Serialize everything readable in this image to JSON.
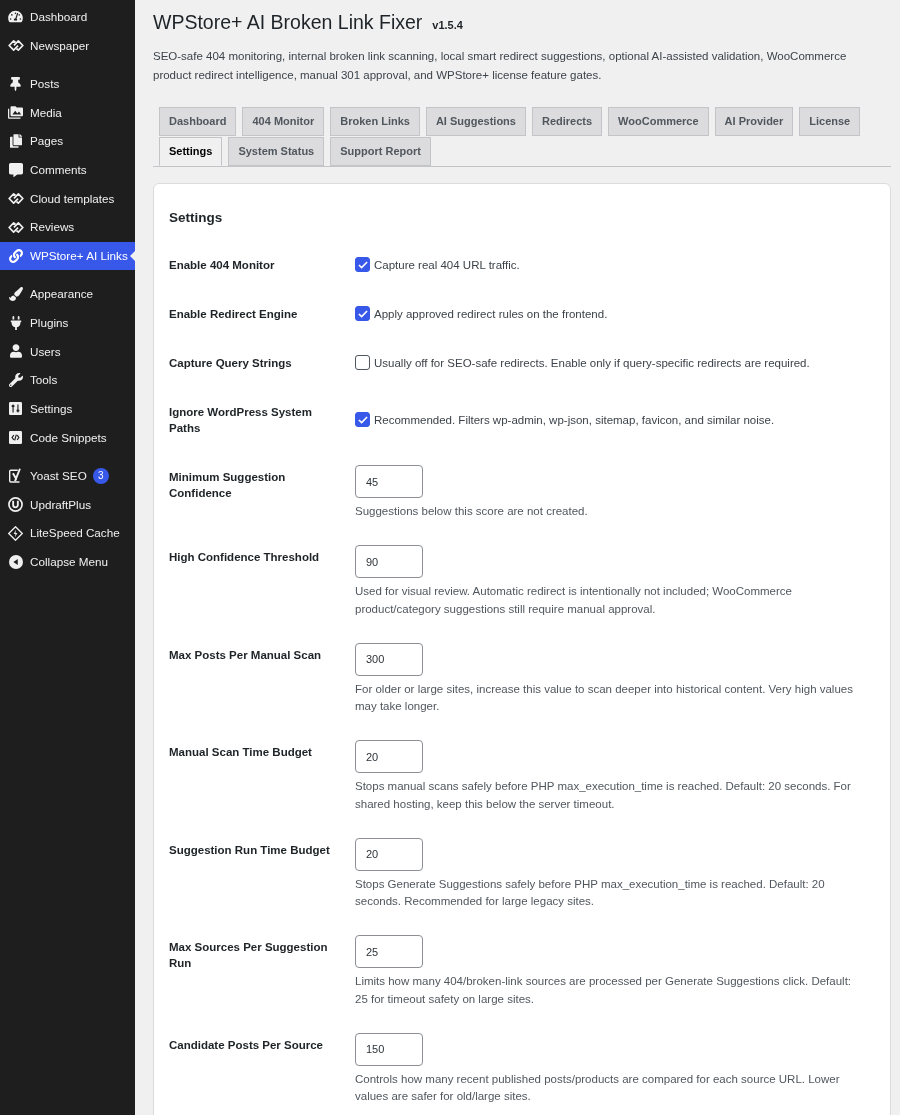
{
  "sidebar": {
    "groups": [
      {
        "items": [
          {
            "label": "Dashboard",
            "selected": false
          },
          {
            "label": "Newspaper",
            "selected": false
          }
        ]
      },
      {
        "items": [
          {
            "label": "Posts",
            "selected": false
          },
          {
            "label": "Media",
            "selected": false
          },
          {
            "label": "Pages",
            "selected": false
          },
          {
            "label": "Comments",
            "selected": false
          },
          {
            "label": "Cloud templates",
            "selected": false
          },
          {
            "label": "Reviews",
            "selected": false
          },
          {
            "label": "WPStore+ AI Links",
            "selected": true
          }
        ]
      },
      {
        "items": [
          {
            "label": "Appearance",
            "selected": false
          },
          {
            "label": "Plugins",
            "selected": false
          },
          {
            "label": "Users",
            "selected": false
          },
          {
            "label": "Tools",
            "selected": false
          },
          {
            "label": "Settings",
            "selected": false
          },
          {
            "label": "Code Snippets",
            "selected": false
          }
        ]
      },
      {
        "items": [
          {
            "label": "Yoast SEO",
            "selected": false,
            "badge": "3"
          },
          {
            "label": "UpdraftPlus",
            "selected": false
          },
          {
            "label": "LiteSpeed Cache",
            "selected": false
          }
        ]
      }
    ],
    "collapse_label": "Collapse Menu"
  },
  "header": {
    "title": "WPStore+ AI Broken Link Fixer",
    "version": "v1.5.4",
    "description": "SEO-safe 404 monitoring, internal broken link scanning, local smart redirect suggestions, optional AI-assisted validation, WooCommerce product redirect intelligence, manual 301 approval, and WPStore+ license feature gates."
  },
  "tab_rows": [
    {
      "tabs": [
        {
          "label": "Dashboard",
          "selected": false
        },
        {
          "label": "404 Monitor",
          "selected": false
        },
        {
          "label": "Broken Links",
          "selected": false
        },
        {
          "label": "AI Suggestions",
          "selected": false
        },
        {
          "label": "Redirects",
          "selected": false
        },
        {
          "label": "WooCommerce",
          "selected": false
        },
        {
          "label": "AI Provider",
          "selected": false
        },
        {
          "label": "License",
          "selected": false
        }
      ]
    },
    {
      "tabs": [
        {
          "label": "Settings",
          "selected": true
        },
        {
          "label": "System Status",
          "selected": false
        },
        {
          "label": "Support Report",
          "selected": false
        }
      ]
    }
  ],
  "settings": {
    "title": "Settings",
    "rows": [
      {
        "kind": "checkbox",
        "label": "Enable 404 Monitor",
        "checked": true,
        "description": "Capture real 404 URL traffic."
      },
      {
        "kind": "checkbox",
        "label": "Enable Redirect Engine",
        "checked": true,
        "description": "Apply approved redirect rules on the frontend."
      },
      {
        "kind": "checkbox",
        "label": "Capture Query Strings",
        "checked": false,
        "description": "Usually off for SEO-safe redirects. Enable only if query-specific redirects are required."
      },
      {
        "kind": "checkbox",
        "label": "Ignore WordPress System Paths",
        "checked": true,
        "description": "Recommended. Filters wp-admin, wp-json, sitemap, favicon, and similar noise."
      },
      {
        "kind": "number",
        "label": "Minimum Suggestion Confidence",
        "value": "45",
        "description": "Suggestions below this score are not created."
      },
      {
        "kind": "number",
        "label": "High Confidence Threshold",
        "value": "90",
        "description": "Used for visual review. Automatic redirect is intentionally not included; WooCommerce product/category suggestions still require manual approval."
      },
      {
        "kind": "number",
        "label": "Max Posts Per Manual Scan",
        "value": "300",
        "description": "For older or large sites, increase this value to scan deeper into historical content. Very high values may take longer."
      },
      {
        "kind": "number",
        "label": "Manual Scan Time Budget",
        "value": "20",
        "description": "Stops manual scans safely before PHP max_execution_time is reached. Default: 20 seconds. For shared hosting, keep this below the server timeout."
      },
      {
        "kind": "number",
        "label": "Suggestion Run Time Budget",
        "value": "20",
        "description": "Stops Generate Suggestions safely before PHP max_execution_time is reached. Default: 20 seconds. Recommended for large legacy sites."
      },
      {
        "kind": "number",
        "label": "Max Sources Per Suggestion Run",
        "value": "25",
        "description": "Limits how many 404/broken-link sources are processed per Generate Suggestions click. Default: 25 for timeout safety on large sites."
      },
      {
        "kind": "number",
        "label": "Candidate Posts Per Source",
        "value": "150",
        "description": "Controls how many recent published posts/products are compared for each source URL. Lower values are safer for old/large sites."
      }
    ]
  }
}
